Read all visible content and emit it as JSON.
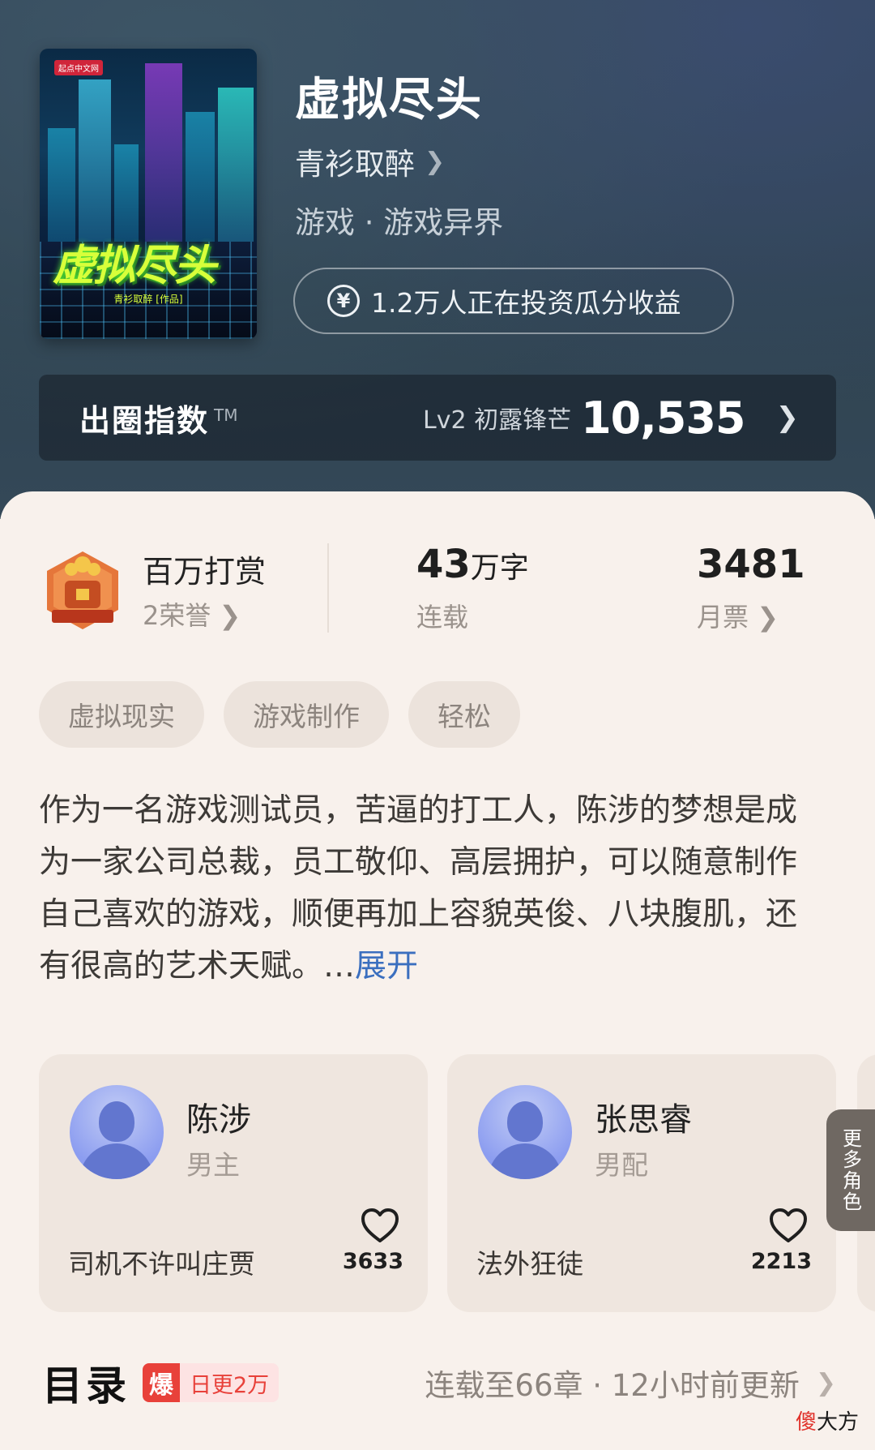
{
  "book": {
    "title": "虚拟尽头",
    "author": "青衫取醉",
    "genre": "游戏 · 游戏异界",
    "invest_text": "1.2万人正在投资瓜分收益",
    "cover": {
      "publisher_badge": "起点中文网",
      "title_art": "虚拟尽头",
      "author_line": "青衫取醉 [作品]"
    }
  },
  "index_bar": {
    "label": "出圈指数",
    "tm": "TM",
    "level": "Lv2 初露锋芒",
    "score": "10,535"
  },
  "stats": {
    "honor_title": "百万打赏",
    "honor_sub": "2荣誉",
    "words_value": "43",
    "words_unit": "万字",
    "words_sub": "连载",
    "ticket_value": "3481",
    "ticket_sub": "月票"
  },
  "tags": [
    "虚拟现实",
    "游戏制作",
    "轻松"
  ],
  "synopsis": {
    "text": "作为一名游戏测试员，苦逼的打工人，陈涉的梦想是成为一家公司总裁，员工敬仰、高层拥护，可以随意制作自己喜欢的游戏，顺便再加上容貌英俊、八块腹肌，还有很高的艺术天赋。…",
    "expand": "展开"
  },
  "characters": [
    {
      "name": "陈涉",
      "role": "男主",
      "voice": "司机不许叫庄贾",
      "likes": "3633"
    },
    {
      "name": "张思睿",
      "role": "男配",
      "voice": "法外狂徒",
      "likes": "2213"
    }
  ],
  "more_roles": "更多角色",
  "toc": {
    "title": "目录",
    "badge_icon": "爆",
    "badge_text": "日更2万",
    "status": "连载至66章 · 12小时前更新"
  },
  "watermark": {
    "accent": "傻",
    "rest": "大方"
  },
  "colors": {
    "link": "#3b6fbf",
    "badge": "#e8413a"
  }
}
